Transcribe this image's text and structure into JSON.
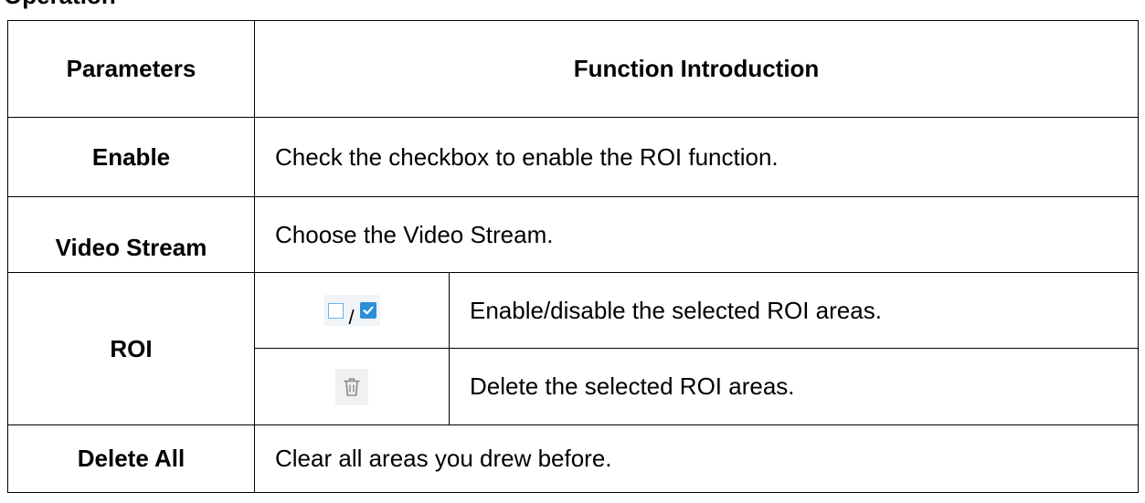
{
  "heading": "Operation",
  "table": {
    "headers": {
      "parameters": "Parameters",
      "function": "Function Introduction"
    },
    "rows": {
      "enable": {
        "param": "Enable",
        "desc": "Check the checkbox to enable the ROI function."
      },
      "video_stream": {
        "param": "Video Stream",
        "desc": "Choose the Video Stream."
      },
      "roi": {
        "param": "ROI",
        "sub": [
          {
            "icon": "checkbox-toggle-icon",
            "separator": "/",
            "desc": "Enable/disable the selected ROI areas."
          },
          {
            "icon": "trash-icon",
            "desc": "Delete the selected ROI areas."
          }
        ]
      },
      "delete_all": {
        "param": "Delete All",
        "desc": "Clear all areas you drew before."
      }
    }
  },
  "colors": {
    "checkbox_border": "#6fb0e8",
    "checkbox_checked": "#2a8fd9",
    "icon_background": "#f1f4f6"
  }
}
